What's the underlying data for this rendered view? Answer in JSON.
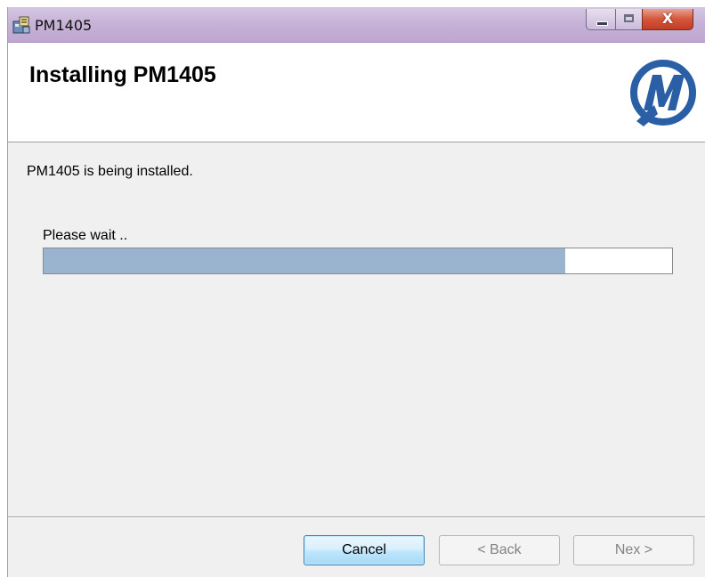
{
  "window": {
    "title": "PM1405",
    "close_glyph": "X"
  },
  "header": {
    "title": "Installing PM1405",
    "logo_icon": "pm-logo-icon"
  },
  "body": {
    "status": "PM1405 is being installed.",
    "wait_label": "Please wait ..",
    "progress": 0.83
  },
  "footer": {
    "cancel_label": "Cancel",
    "back_label": "< Back",
    "next_label": "Nex >"
  },
  "colors": {
    "progress_fill": "#9ab3cf",
    "logo_blue": "#2a5fa6",
    "titlebar": "#c7b3d7",
    "close_button": "#d5553c"
  }
}
